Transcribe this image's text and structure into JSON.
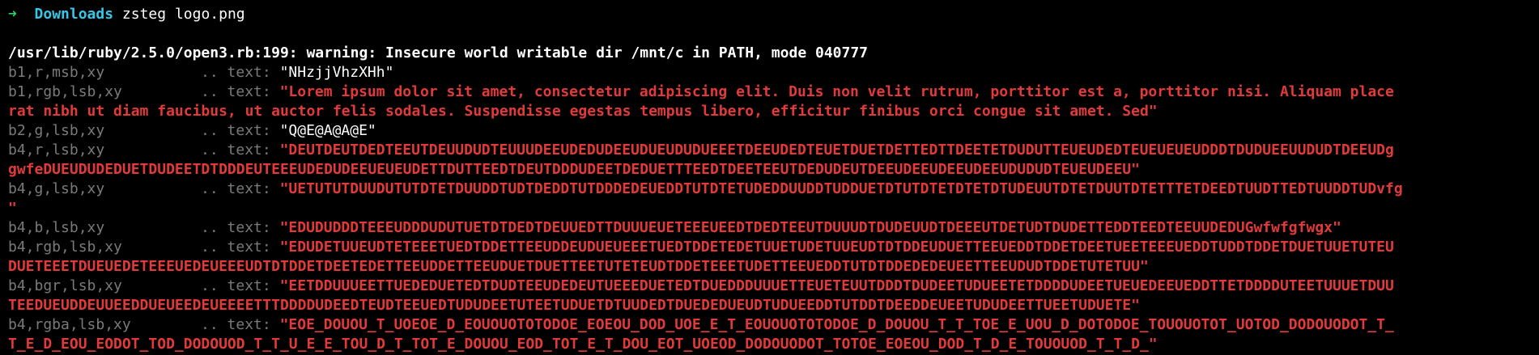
{
  "prompt": {
    "arrow": "➜",
    "dir": "Downloads",
    "command": "zsteg logo.png"
  },
  "warning": "/usr/lib/ruby/2.5.0/open3.rb:199: warning: Insecure world writable dir /mnt/c in PATH, mode 040777",
  "colors": {
    "background": "#000000",
    "prompt_arrow": "#2fd06a",
    "prompt_dir": "#37c6e6",
    "key": "#7a7a7a",
    "value_red": "#e23a3a",
    "value_plain": "#ffffff"
  },
  "results": [
    {
      "key": "b1,r,msb,xy",
      "dots": "..",
      "label": "text:",
      "style": "plain",
      "value": "\"NHzjjVhzXHh\""
    },
    {
      "key": "b1,rgb,lsb,xy",
      "dots": "..",
      "label": "text:",
      "style": "red",
      "value": "\"Lorem ipsum dolor sit amet, consectetur adipiscing elit. Duis non velit rutrum, porttitor est a, porttitor nisi. Aliquam place",
      "cont": "rat nibh ut diam faucibus, ut auctor felis sodales. Suspendisse egestas tempus libero, efficitur finibus orci congue sit amet. Sed\""
    },
    {
      "key": "b2,g,lsb,xy",
      "dots": "..",
      "label": "text:",
      "style": "plain",
      "value": "\"Q@E@A@A@E\""
    },
    {
      "key": "b4,r,lsb,xy",
      "dots": "..",
      "label": "text:",
      "style": "red",
      "value": "\"DEUTDEUTDEDTEEUTDEUUDUDTEUUUDEEUDEDUDEEUDUEUDUDUEEETDEEUDEDTEUETDUETDETTEDTTDEETETDUDUTTEUEUDEDTEUEUEUEUDDDTDUDUEEUUDUDTDEEUDg",
      "cont": "gwfeDUEUDUDEDUETDUDEETDTDDDEUTEEEUDEDUDEEUEUEUDETTDUTTEEDTDEUTDDDUDEETDEDUETTTEEDTDEETEEUTDEDUDEUTDEEUDEEUDEEUDEEUDUDUDTEUEUDEEU\""
    },
    {
      "key": "b4,g,lsb,xy",
      "dots": "..",
      "label": "text:",
      "style": "red",
      "value": "\"UETUTUTDUUDUTUTDTETDUUDDTUDTDEDDTUTDDDEDEUEDDTUTDTETUDEDDUUDDTUDDUETDTUTDTETDTETDTUDEUUTDTETDUUTDTETTTETDEEDTUUDTTEDTUUDDTUDvfg",
      "cont": "\""
    },
    {
      "key": "b4,b,lsb,xy",
      "dots": "..",
      "label": "text:",
      "style": "red",
      "value": "\"EDUDUDDDTEEEUDDDUDUTUETDTDEDTDEUUEDTTDUUUEUETEEEUEEDTDEDTEEUTDUUUDTDUDEUUDTDEEEUTDETUDTDUDETTEDDTEEDTEEUUDEDUGwfwfgfwgx\""
    },
    {
      "key": "b4,rgb,lsb,xy",
      "dots": "..",
      "label": "text:",
      "style": "red",
      "value": "\"EDUDETUUEUDTETEEETUEDTDDETTEEUDDEUDUEUEEETUEDTDDETEDETUUETUDETUUEUDTDTDDEUDUETTEEUEDDTDDETDEETUEETEEEUEDDTUDDTDDETDUETUUETUTEU",
      "cont": "DUETEEETDUEUEDETEEEUEDEUEEEUDTDTDDETDEETEDETTEEUDDETTEEUDUETDUETTEETUTETEUDTDDETEEETUDETTEEUEDDTUTDTDDEDEDEUEETTEEUDUDTDDETUTETUU\""
    },
    {
      "key": "b4,bgr,lsb,xy",
      "dots": "..",
      "label": "text:",
      "style": "red",
      "value": "\"EETDDUUUEETTUEDEDUETEDTDUDTEEUDEDEUTUEEEDUETEDTDUEDDDUUUETTEUETEUUTDDDTDUDEETUDUEETETDDDDUDEETUEUEDEEUEDDTTETDDDDUTEETUUUETDUU",
      "cont": "TEEDUEUDDEUUEEDDUEUEEDEUEEEETTTDDDDUDEEDTEUDTEEUEDTUDUDEETUTEETUDUETDTUUDEDTDUEDEDUEUDTUDUEEDDTUTDDTDEEDDEUEETUDUDEETTUEETUDUETE\""
    },
    {
      "key": "b4,rgba,lsb,xy",
      "dots": "..",
      "label": "text:",
      "style": "red",
      "value": "\"EOE_DOUOU_T_UOEOE_D_EOUOUOTOTODOE_EOEOU_DOD_UOE_E_T_EOUOUOTOTODOE_D_DOUOU_T_T_TOE_E_UOU_D_DOTODOE_TOUOUOTOT_UOTOD_DODOUODOT_T_",
      "cont": "T_E_D_EOU_EODOT_TOD_DODOUOD_T_T_U_E_E_TOU_D_T_TOT_E_DOUOU_EOD_TOT_E_T_DOU_EOT_UOEOD_DODOUODOT_TOTOE_EOEOU_DOD_T_D_E_TOUOUOD_T_T_D_\""
    }
  ]
}
